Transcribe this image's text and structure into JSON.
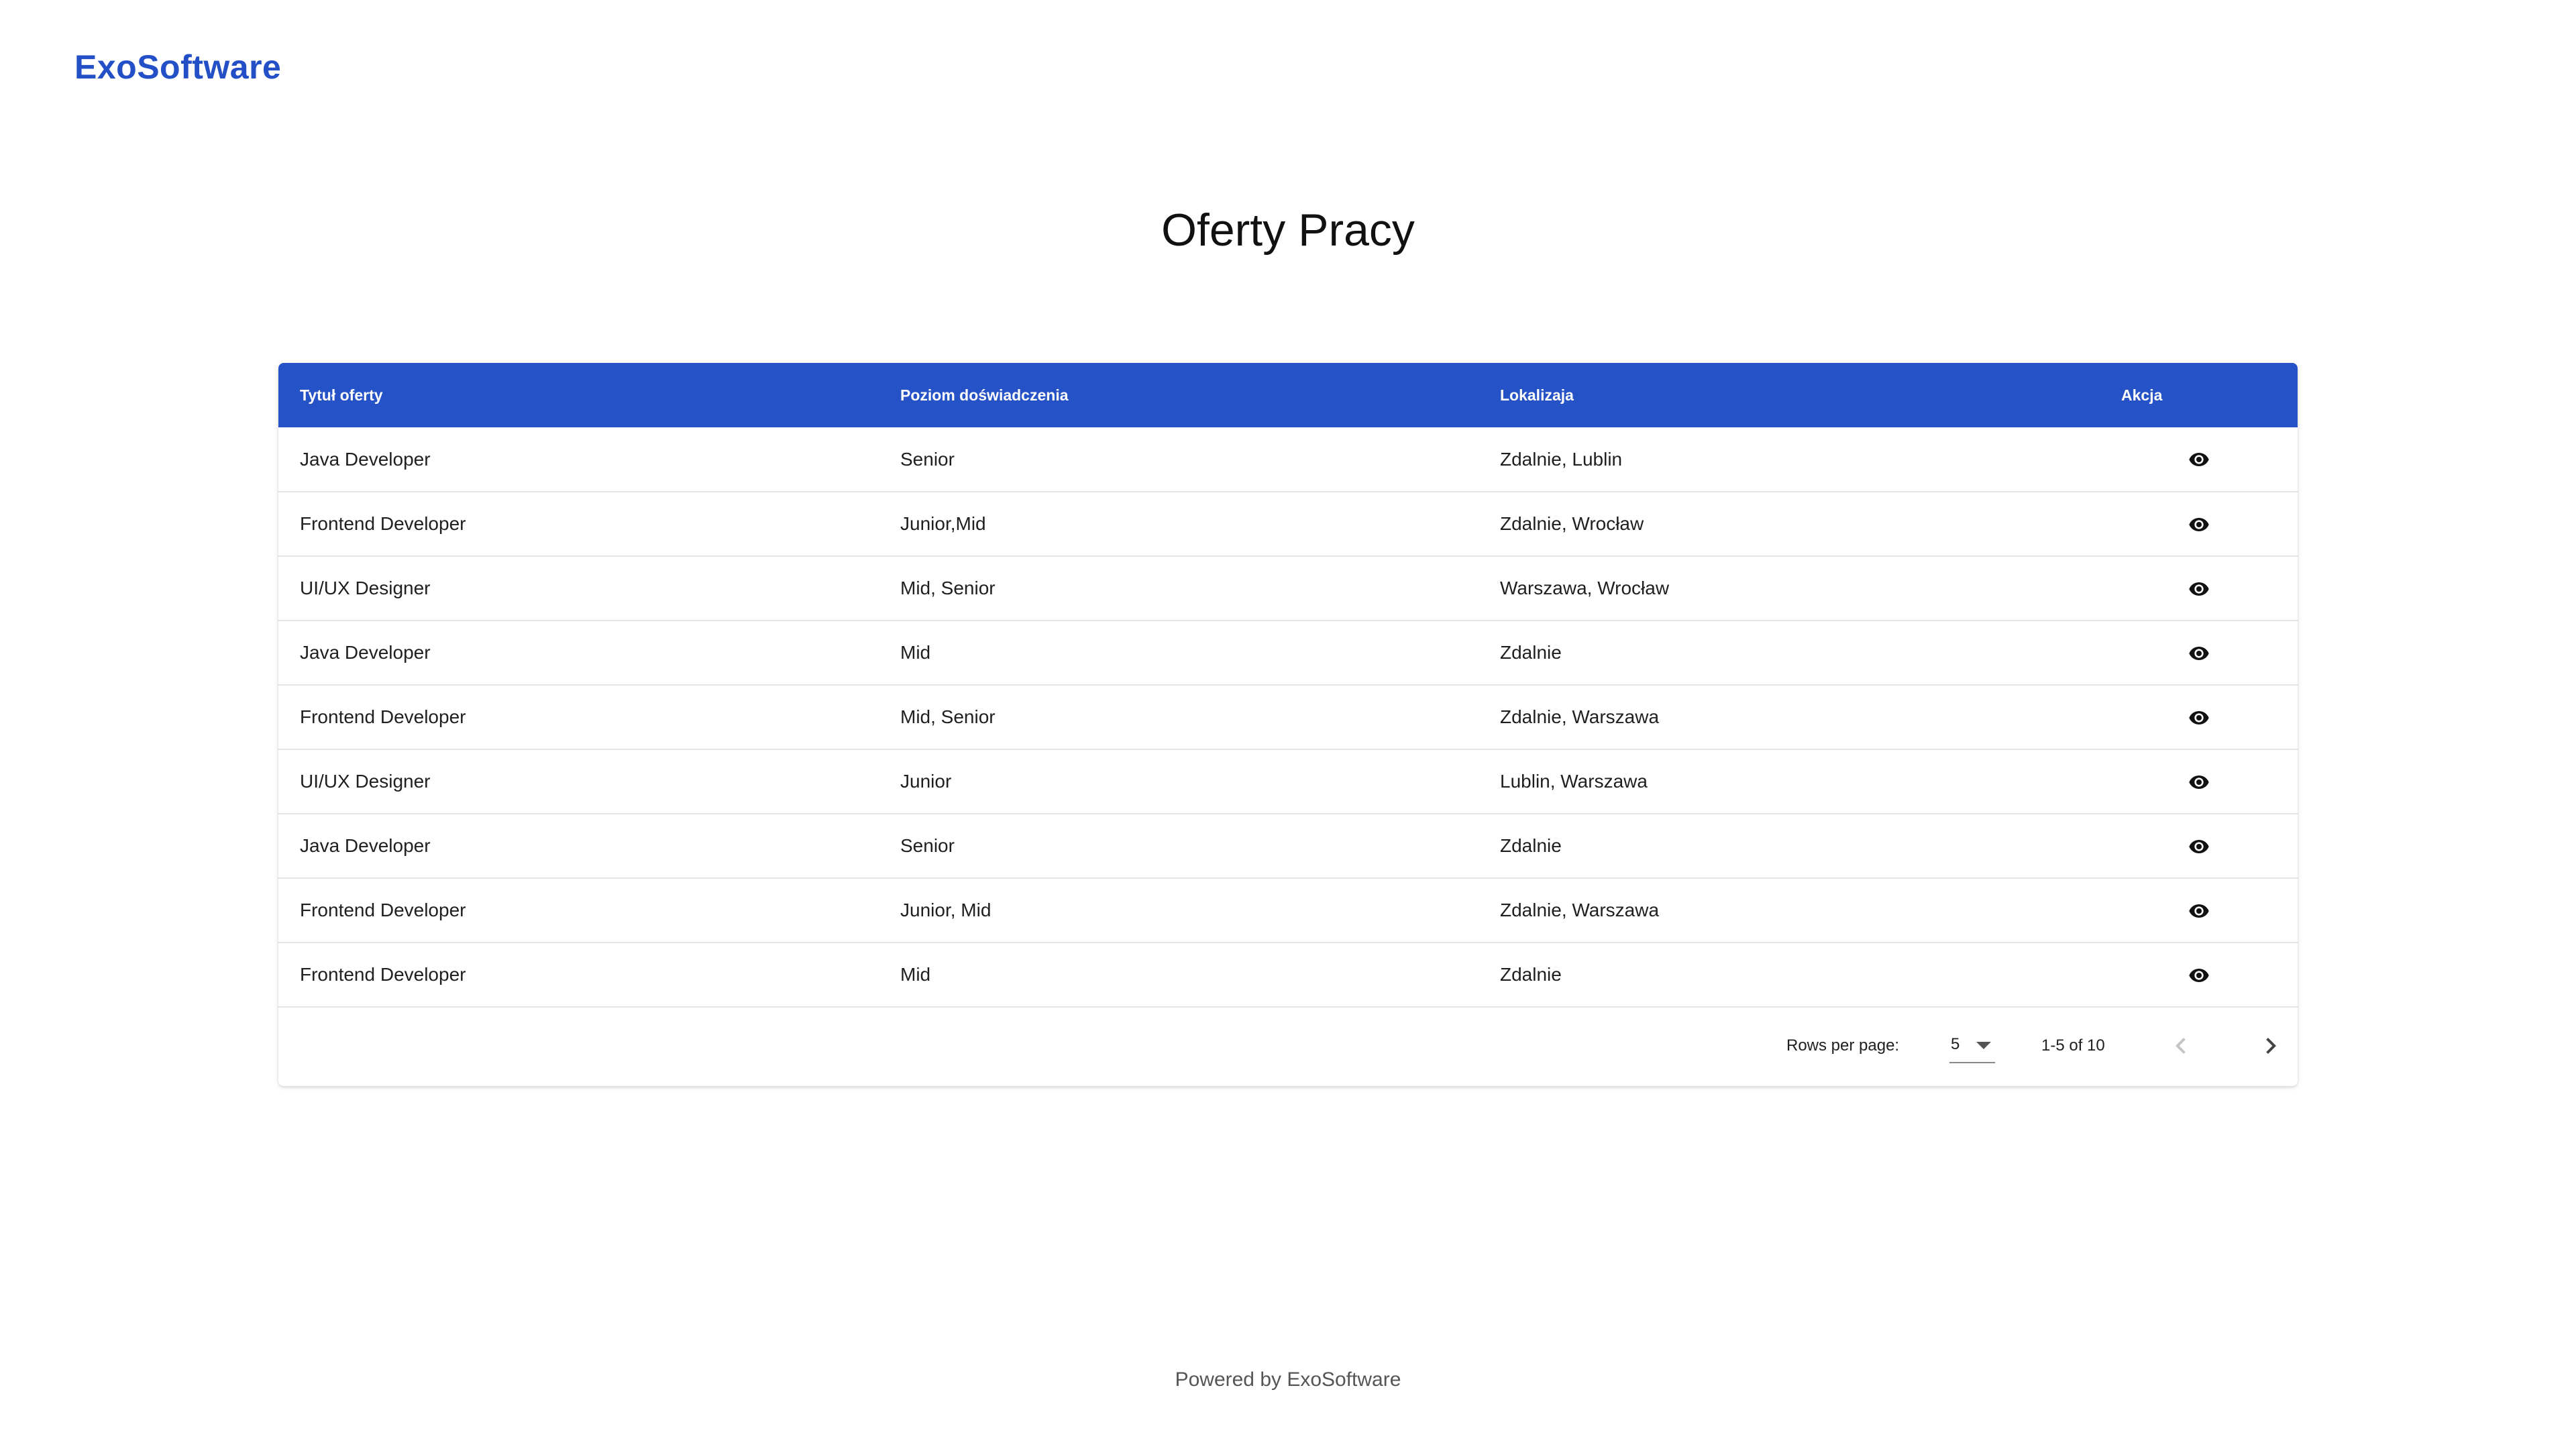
{
  "header": {
    "brand": "ExoSoftware"
  },
  "main": {
    "title": "Oferty Pracy"
  },
  "table": {
    "columns": [
      "Tytuł oferty",
      "Poziom doświadczenia",
      "Lokalizaja",
      "Akcja"
    ],
    "rows": [
      {
        "title": "Java Developer",
        "level": "Senior",
        "location": "Zdalnie, Lublin",
        "action_icon": "eye-icon"
      },
      {
        "title": "Frontend Developer",
        "level": "Junior,Mid",
        "location": "Zdalnie, Wrocław",
        "action_icon": "eye-icon"
      },
      {
        "title": "UI/UX Designer",
        "level": "Mid, Senior",
        "location": "Warszawa, Wrocław",
        "action_icon": "eye-icon"
      },
      {
        "title": "Java Developer",
        "level": "Mid",
        "location": "Zdalnie",
        "action_icon": "eye-icon"
      },
      {
        "title": "Frontend Developer",
        "level": "Mid, Senior",
        "location": "Zdalnie, Warszawa",
        "action_icon": "eye-icon"
      },
      {
        "title": "UI/UX Designer",
        "level": "Junior",
        "location": "Lublin, Warszawa",
        "action_icon": "eye-icon"
      },
      {
        "title": "Java Developer",
        "level": "Senior",
        "location": "Zdalnie",
        "action_icon": "eye-icon"
      },
      {
        "title": "Frontend Developer",
        "level": "Junior, Mid",
        "location": "Zdalnie, Warszawa",
        "action_icon": "eye-icon"
      },
      {
        "title": "Frontend Developer",
        "level": "Mid",
        "location": "Zdalnie",
        "action_icon": "eye-icon"
      }
    ]
  },
  "pagination": {
    "rows_per_page_label": "Rows per page:",
    "rows_per_page_value": "5",
    "range_text": "1-5 of 10",
    "prev_icon": "chevron-left-icon",
    "next_icon": "chevron-right-icon"
  },
  "footer": {
    "text": "Powered by ExoSoftware"
  },
  "colors": {
    "brand": "#2350c7",
    "header_bg": "#2652c8"
  }
}
